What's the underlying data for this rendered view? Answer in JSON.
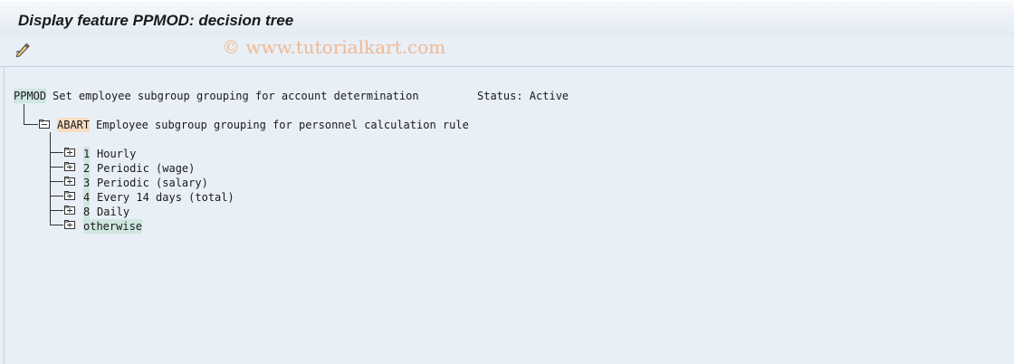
{
  "window": {
    "title": "Display feature PPMOD: decision tree"
  },
  "watermark": "© www.tutorialkart.com",
  "toolbar": {
    "buttons": [
      {
        "icon": "edit-pencil-icon"
      }
    ]
  },
  "tree": {
    "root": {
      "key": "PPMOD",
      "text": "Set employee subgroup grouping for account determination",
      "status": "Status: Active"
    },
    "level1": {
      "key": "ABART",
      "text": "Employee subgroup grouping for personnel calculation rule",
      "icon": "folder-open-icon"
    },
    "children": [
      {
        "key": "1",
        "text": "Hourly",
        "icon": "folder-closed-icon"
      },
      {
        "key": "2",
        "text": "Periodic (wage)",
        "icon": "folder-closed-icon"
      },
      {
        "key": "3",
        "text": "Periodic (salary)",
        "icon": "folder-closed-icon"
      },
      {
        "key": "4",
        "text": "Every 14 days (total)",
        "icon": "folder-closed-icon"
      },
      {
        "key": "8",
        "text": "Daily",
        "icon": "folder-closed-icon"
      },
      {
        "key": "otherwise",
        "text": "",
        "icon": "folder-closed-icon"
      }
    ]
  }
}
